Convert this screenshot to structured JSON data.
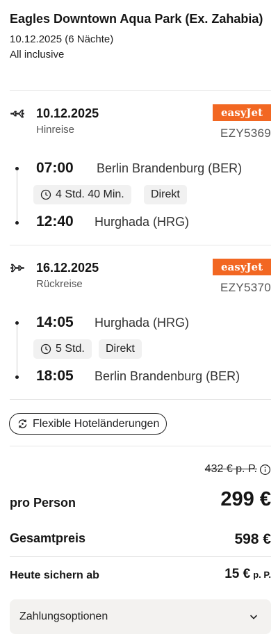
{
  "hotel": {
    "name": "Eagles Downtown Aqua Park (Ex. Zahabia)",
    "dates": "10.12.2025 (6 Nächte)",
    "board": "All inclusive"
  },
  "outbound": {
    "icon": "plane-departure-icon",
    "date": "10.12.2025",
    "direction": "Hinreise",
    "airline": "easyJet",
    "flight_number": "EZY5369",
    "departure_time": "07:00",
    "departure_airport": "Berlin Brandenburg (BER)",
    "duration": "4 Std. 40 Min.",
    "stops": "Direkt",
    "arrival_time": "12:40",
    "arrival_airport": "Hurghada (HRG)"
  },
  "inbound": {
    "icon": "plane-arrival-icon",
    "date": "16.12.2025",
    "direction": "Rückreise",
    "airline": "easyJet",
    "flight_number": "EZY5370",
    "departure_time": "14:05",
    "departure_airport": "Hurghada (HRG)",
    "duration": "5 Std.",
    "stops": "Direkt",
    "arrival_time": "18:05",
    "arrival_airport": "Berlin Brandenburg (BER)"
  },
  "flex": {
    "label": "Flexible Hoteländerungen"
  },
  "pricing": {
    "old_price": "432 € p. P.",
    "per_person_label": "pro Person",
    "per_person_value": "299 €",
    "total_label": "Gesamtpreis",
    "total_value": "598 €",
    "deposit_label": "Heute sichern ab",
    "deposit_value": "15 €",
    "deposit_unit": "p. P."
  },
  "payment": {
    "label": "Zahlungsoptionen"
  },
  "colors": {
    "airline_brand": "#f26722",
    "chip_bg": "#f1f1f1",
    "panel_bg": "#f3f2f0"
  }
}
